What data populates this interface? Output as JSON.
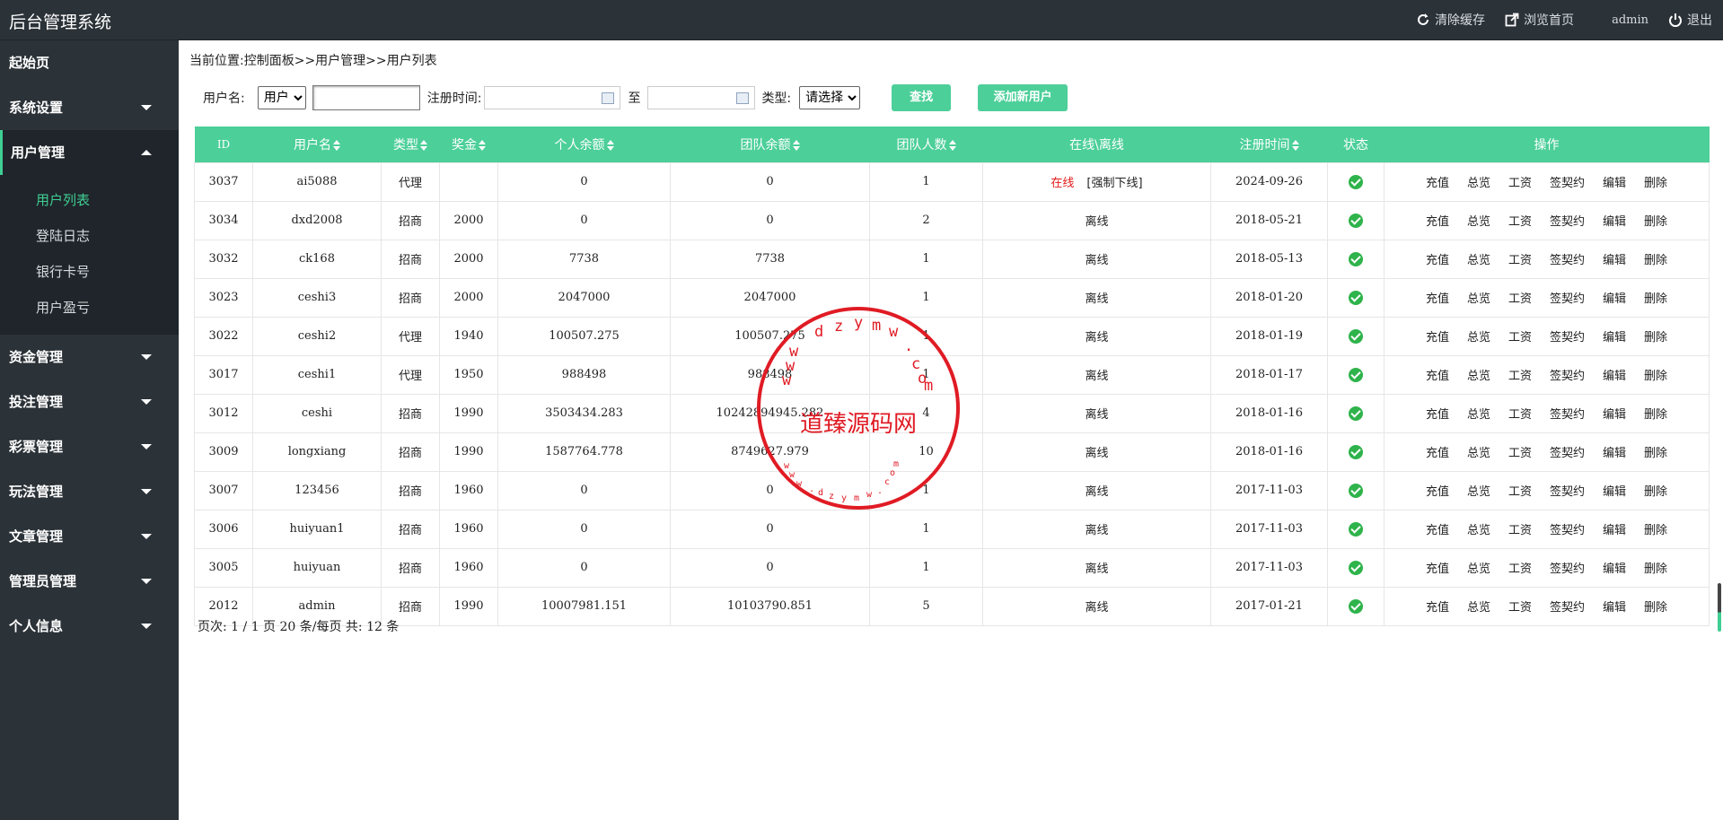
{
  "app": {
    "title": "后台管理系统"
  },
  "toolbar": {
    "clear_cache": "清除缓存",
    "browse_home": "浏览首页",
    "user": "admin",
    "logout": "退出"
  },
  "sidebar": {
    "items": [
      {
        "label": "起始页"
      },
      {
        "label": "系统设置"
      },
      {
        "label": "用户管理"
      },
      {
        "label": "资金管理"
      },
      {
        "label": "投注管理"
      },
      {
        "label": "彩票管理"
      },
      {
        "label": "玩法管理"
      },
      {
        "label": "文章管理"
      },
      {
        "label": "管理员管理"
      },
      {
        "label": "个人信息"
      }
    ],
    "sub_items": [
      {
        "label": "用户列表"
      },
      {
        "label": "登陆日志"
      },
      {
        "label": "银行卡号"
      },
      {
        "label": "用户盈亏"
      }
    ]
  },
  "breadcrumb": "当前位置:控制面板>>用户管理>>用户列表",
  "filter": {
    "username_label": "用户名:",
    "username_type": "用户",
    "username_value": "",
    "regtime_label": "注册时间:",
    "to_label": "至",
    "type_label": "类型:",
    "type_value": "请选择",
    "search_button": "查找",
    "add_button": "添加新用户"
  },
  "table": {
    "headers": [
      "ID",
      "用户名",
      "类型",
      "奖金",
      "个人余额",
      "团队余额",
      "团队人数",
      "在线\\离线",
      "注册时间",
      "状态",
      "操作"
    ],
    "online_text": "在线",
    "force_offline": "[强制下线]",
    "actions": [
      "充值",
      "总览",
      "工资",
      "签契约",
      "编辑",
      "删除"
    ],
    "rows": [
      {
        "id": "3037",
        "username": "ai5088",
        "type": "代理",
        "bonus": "",
        "balance": "0",
        "team_balance": "0",
        "team_count": "1",
        "status": "online",
        "offline_text": "",
        "reg_date": "2024-09-26"
      },
      {
        "id": "3034",
        "username": "dxd2008",
        "type": "招商",
        "bonus": "2000",
        "balance": "0",
        "team_balance": "0",
        "team_count": "2",
        "status": "offline",
        "offline_text": "离线",
        "reg_date": "2018-05-21"
      },
      {
        "id": "3032",
        "username": "ck168",
        "type": "招商",
        "bonus": "2000",
        "balance": "7738",
        "team_balance": "7738",
        "team_count": "1",
        "status": "offline",
        "offline_text": "离线",
        "reg_date": "2018-05-13"
      },
      {
        "id": "3023",
        "username": "ceshi3",
        "type": "招商",
        "bonus": "2000",
        "balance": "2047000",
        "team_balance": "2047000",
        "team_count": "1",
        "status": "offline",
        "offline_text": "离线",
        "reg_date": "2018-01-20"
      },
      {
        "id": "3022",
        "username": "ceshi2",
        "type": "代理",
        "bonus": "1940",
        "balance": "100507.275",
        "team_balance": "100507.275",
        "team_count": "1",
        "status": "offline",
        "offline_text": "离线",
        "reg_date": "2018-01-19"
      },
      {
        "id": "3017",
        "username": "ceshi1",
        "type": "代理",
        "bonus": "1950",
        "balance": "988498",
        "team_balance": "988498",
        "team_count": "1",
        "status": "offline",
        "offline_text": "离线",
        "reg_date": "2018-01-17"
      },
      {
        "id": "3012",
        "username": "ceshi",
        "type": "招商",
        "bonus": "1990",
        "balance": "3503434.283",
        "team_balance": "10242894945.282",
        "team_count": "4",
        "status": "offline",
        "offline_text": "离线",
        "reg_date": "2018-01-16"
      },
      {
        "id": "3009",
        "username": "longxiang",
        "type": "招商",
        "bonus": "1990",
        "balance": "1587764.778",
        "team_balance": "8749627.979",
        "team_count": "10",
        "status": "offline",
        "offline_text": "离线",
        "reg_date": "2018-01-16"
      },
      {
        "id": "3007",
        "username": "123456",
        "type": "招商",
        "bonus": "1960",
        "balance": "0",
        "team_balance": "0",
        "team_count": "1",
        "status": "offline",
        "offline_text": "离线",
        "reg_date": "2017-11-03"
      },
      {
        "id": "3006",
        "username": "huiyuan1",
        "type": "招商",
        "bonus": "1960",
        "balance": "0",
        "team_balance": "0",
        "team_count": "1",
        "status": "offline",
        "offline_text": "离线",
        "reg_date": "2017-11-03"
      },
      {
        "id": "3005",
        "username": "huiyuan",
        "type": "招商",
        "bonus": "1960",
        "balance": "0",
        "team_balance": "0",
        "team_count": "1",
        "status": "offline",
        "offline_text": "离线",
        "reg_date": "2017-11-03"
      },
      {
        "id": "2012",
        "username": "admin",
        "type": "招商",
        "bonus": "1990",
        "balance": "10007981.151",
        "team_balance": "10103790.851",
        "team_count": "5",
        "status": "offline",
        "offline_text": "离线",
        "reg_date": "2017-01-21"
      }
    ]
  },
  "pager": "页次: 1 / 1 页 20 条/每页 共: 12 条",
  "watermark": {
    "main": "道臻源码网",
    "ring_text": "dzymw.com",
    "inner_text": "www.dzymw.com"
  },
  "colors": {
    "accent": "#4ccf99",
    "sidebar_bg": "#2b3238",
    "online_red": "#e41a1a",
    "stamp_red": "#e01b24"
  }
}
